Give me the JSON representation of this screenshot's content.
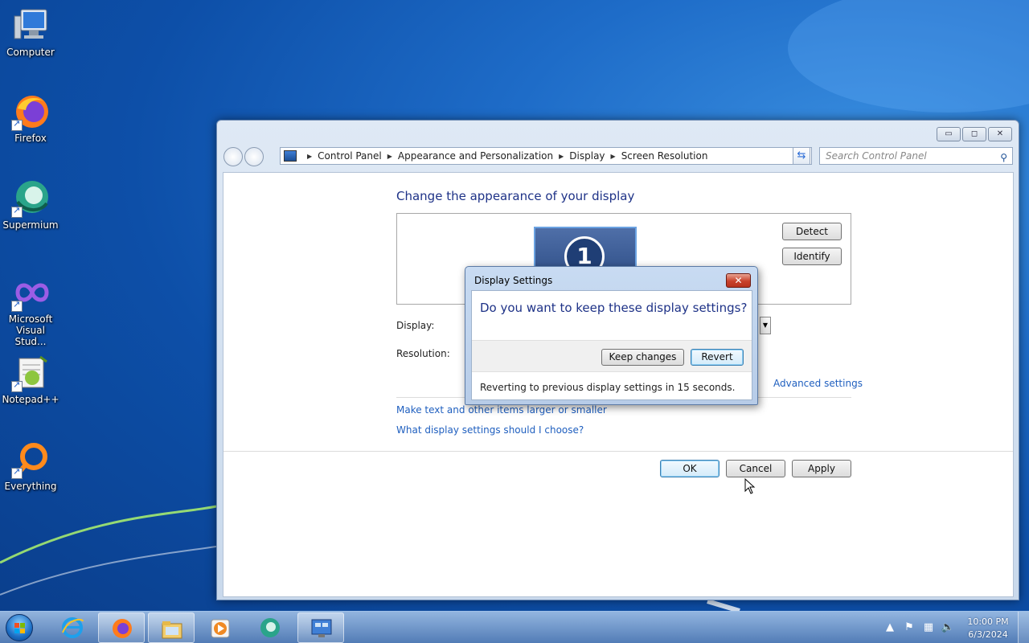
{
  "desktop": {
    "icons": [
      {
        "label": "Computer",
        "icon": "computer-icon"
      },
      {
        "label": "Firefox",
        "icon": "firefox-icon"
      },
      {
        "label": "Supermium",
        "icon": "supermium-icon"
      },
      {
        "label": "Microsoft Visual Stud...",
        "label_line1": "Microsoft",
        "label_line2": "Visual Stud...",
        "icon": "visual-studio-icon"
      },
      {
        "label": "Notepad++",
        "icon": "notepad-plus-plus-icon"
      },
      {
        "label": "Everything",
        "icon": "everything-search-icon"
      }
    ]
  },
  "window": {
    "controls": {
      "minimize": "▭",
      "maximize": "◻",
      "close": "✕"
    },
    "breadcrumb": [
      "Control Panel",
      "Appearance and Personalization",
      "Display",
      "Screen Resolution"
    ],
    "search_placeholder": "Search Control Panel",
    "heading": "Change the appearance of your display",
    "monitor_number": "1",
    "detect_label": "Detect",
    "identify_label": "Identify",
    "display_label": "Display:",
    "resolution_label": "Resolution:",
    "advanced_link": "Advanced settings",
    "link_text_size": "Make text and other items larger or smaller",
    "link_help": "What display settings should I choose?",
    "ok_label": "OK",
    "cancel_label": "Cancel",
    "apply_label": "Apply"
  },
  "dialog": {
    "title": "Display Settings",
    "close_glyph": "✕",
    "question": "Do you want to keep these display settings?",
    "keep_label": "Keep changes",
    "revert_label": "Revert",
    "countdown_text": "Reverting to previous display settings in 15 seconds."
  },
  "taskbar": {
    "items": [
      "internet-explorer-icon",
      "firefox-icon",
      "file-explorer-icon",
      "media-player-icon",
      "supermium-icon",
      "display-settings-icon"
    ],
    "active_item": "display-settings-icon",
    "clock_time": "10:00 PM",
    "clock_date": "6/3/2024"
  },
  "colors": {
    "heading": "#1e3287",
    "link": "#1f5fbf",
    "desktop_blue": "#1e6cc8"
  }
}
